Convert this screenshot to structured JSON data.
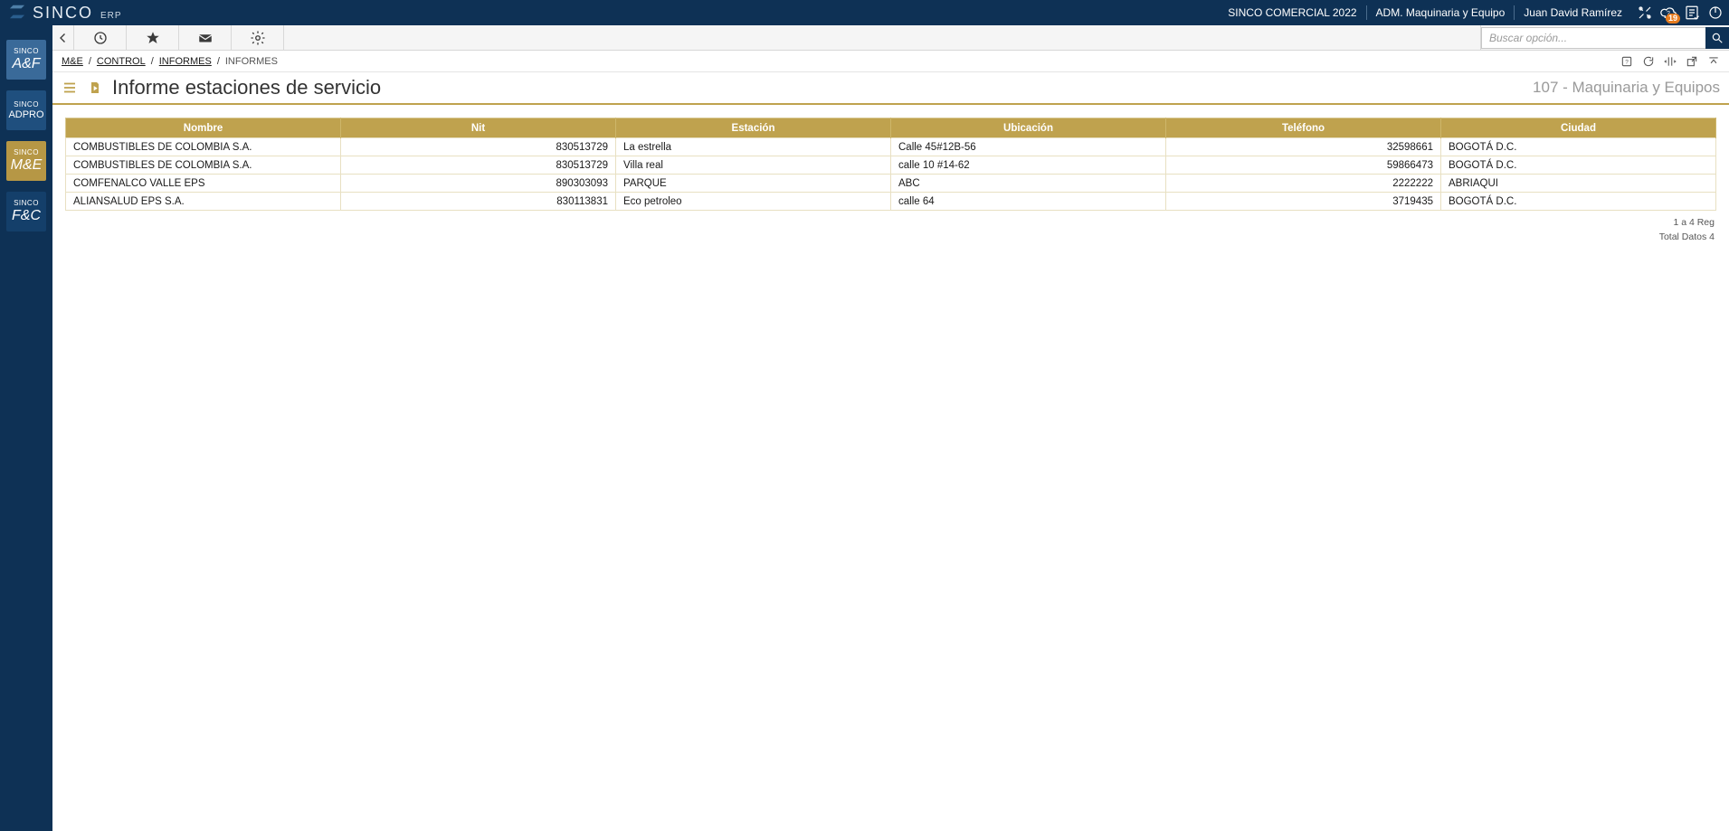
{
  "brand": {
    "name": "SINCO",
    "suffix": "ERP"
  },
  "topbar": {
    "company": "SINCO COMERCIAL 2022",
    "module": "ADM. Maquinaria y Equipo",
    "user": "Juan David Ramírez",
    "notification_badge": "19"
  },
  "sidebar_apps": [
    {
      "sup": "SINCO",
      "label": "A&F",
      "cls": "ai-blue1"
    },
    {
      "sup": "SINCO",
      "label": "ADPRO",
      "cls": "ai-blue2"
    },
    {
      "sup": "SINCO",
      "label": "M&E",
      "cls": "ai-gold"
    },
    {
      "sup": "SINCO",
      "label": "F&C",
      "cls": "ai-blue3"
    }
  ],
  "search": {
    "placeholder": "Buscar opción..."
  },
  "breadcrumbs": {
    "items": [
      "M&E",
      "CONTROL",
      "INFORMES"
    ],
    "current": "INFORMES"
  },
  "page": {
    "title": "Informe estaciones de servicio",
    "context": "107 - Maquinaria y Equipos"
  },
  "table": {
    "columns": [
      "Nombre",
      "Nit",
      "Estación",
      "Ubicación",
      "Teléfono",
      "Ciudad"
    ],
    "rows": [
      {
        "nombre": "COMBUSTIBLES DE COLOMBIA S.A.",
        "nit": "830513729",
        "estacion": "La estrella",
        "ubicacion": "Calle 45#12B-56",
        "telefono": "32598661",
        "ciudad": "BOGOTÁ D.C."
      },
      {
        "nombre": "COMBUSTIBLES DE COLOMBIA S.A.",
        "nit": "830513729",
        "estacion": "Villa real",
        "ubicacion": "calle 10 #14-62",
        "telefono": "59866473",
        "ciudad": "BOGOTÁ D.C."
      },
      {
        "nombre": "COMFENALCO VALLE EPS",
        "nit": "890303093",
        "estacion": "PARQUE",
        "ubicacion": "ABC",
        "telefono": "2222222",
        "ciudad": "ABRIAQUI"
      },
      {
        "nombre": "ALIANSALUD EPS S.A.",
        "nit": "830113831",
        "estacion": "Eco petroleo",
        "ubicacion": "calle 64",
        "telefono": "3719435",
        "ciudad": "BOGOTÁ D.C."
      }
    ],
    "footer_range": "1 a 4 Reg",
    "footer_total": "Total Datos 4"
  }
}
